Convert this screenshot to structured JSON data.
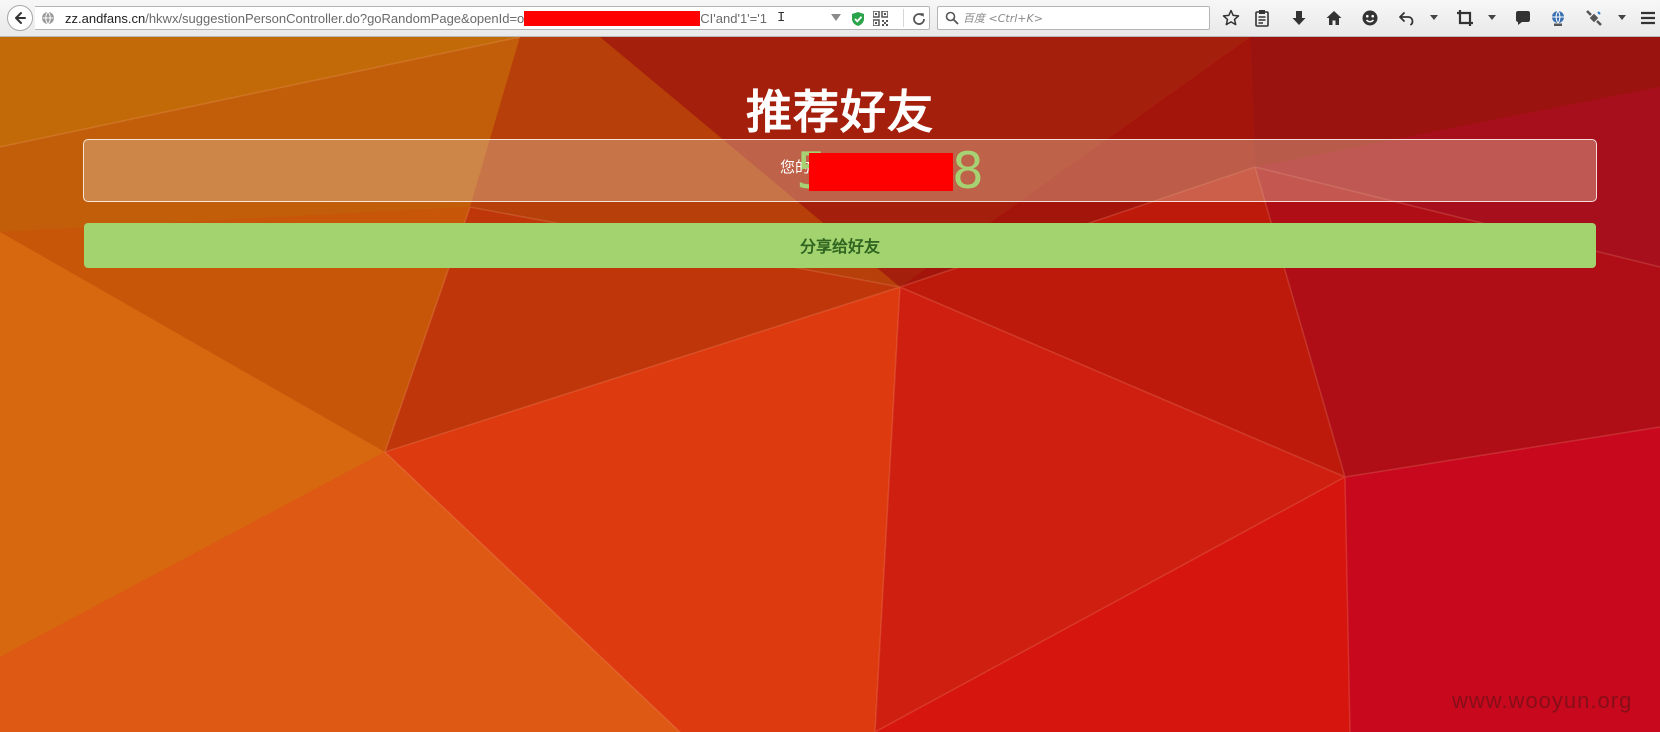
{
  "browser": {
    "url": {
      "host": "zz.andfans.cn",
      "path_before": "/hkwx/suggestionPersonController.do?goRandomPage&openId=o",
      "path_after": "CI'and'1'='1"
    },
    "search_placeholder": "百度 <Ctrl+K>"
  },
  "page": {
    "title": "推荐好友",
    "code_label": "您的推荐码：",
    "code_first_digit": "5",
    "code_last_digit": "8",
    "share_button_label": "分享给好友"
  },
  "watermark": "www.wooyun.org",
  "colors": {
    "share_button": "#a3d36f",
    "code_digits": "#a7d273",
    "redaction": "#ff0000"
  }
}
